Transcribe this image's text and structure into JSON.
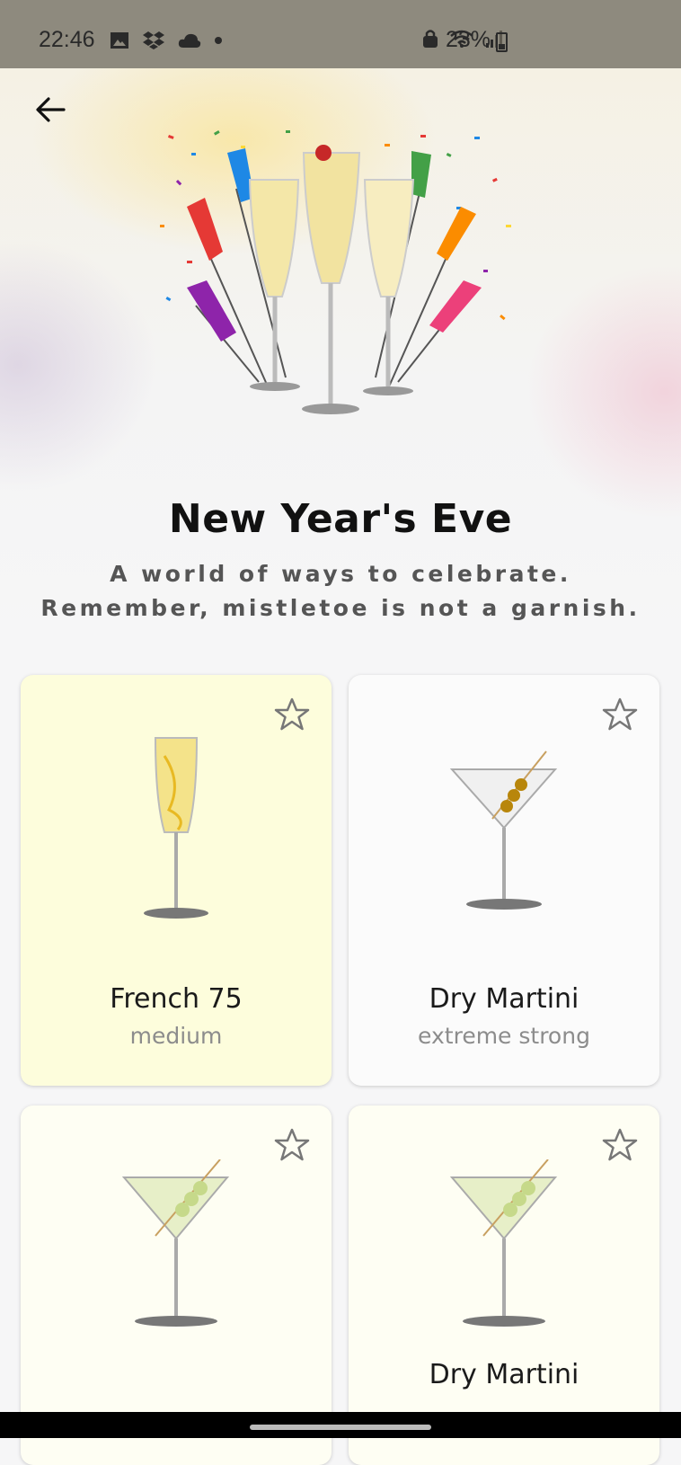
{
  "status_bar": {
    "time": "22:46",
    "battery": "23%",
    "icons": [
      "image-icon",
      "dropbox-icon",
      "cloud-icon",
      "dot-icon",
      "lock-icon",
      "wifi-icon",
      "signal-icon",
      "battery-icon"
    ]
  },
  "header": {
    "back_icon": "arrow-left-icon",
    "title": "New Year's Eve",
    "subtitle_line1": "A world of ways to celebrate.",
    "subtitle_line2": "Remember, mistletoe is not a garnish."
  },
  "cocktails": [
    {
      "name": "French 75",
      "strength": "medium",
      "glass": "champagne-flute",
      "background": "#fdfddc"
    },
    {
      "name": "Dry Martini",
      "strength": "extreme strong",
      "glass": "martini-olives",
      "background": "#fbfbfb"
    },
    {
      "name": "",
      "strength": "",
      "glass": "martini-green",
      "background": "#fefef3"
    },
    {
      "name": "Dry Martini",
      "strength": "",
      "glass": "martini-green",
      "background": "#fefef3"
    }
  ],
  "colors": {
    "accent_yellow": "#fdfddc",
    "text_dark": "#111111",
    "text_muted": "#8c8c8c"
  }
}
